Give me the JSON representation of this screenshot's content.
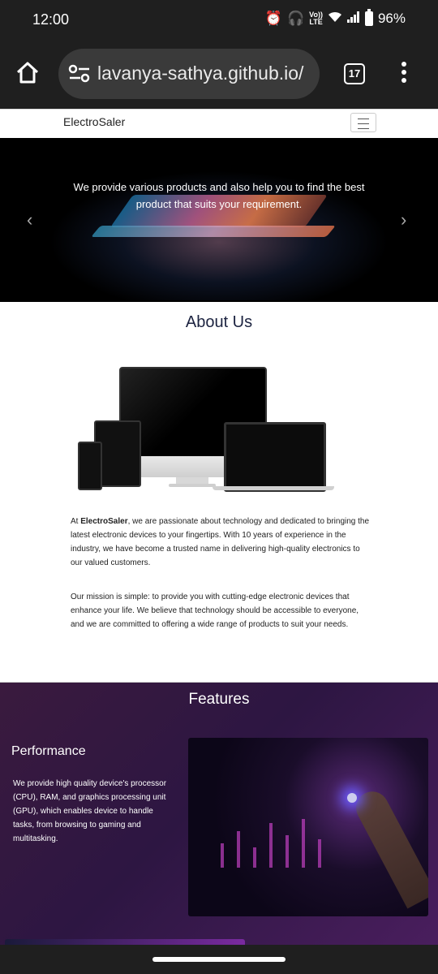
{
  "status_bar": {
    "time": "12:00",
    "network_label_top": "Vo))",
    "network_label_bottom": "LTE",
    "battery": "96%"
  },
  "browser": {
    "url": "lavanya-sathya.github.io/",
    "tab_count": "17"
  },
  "site": {
    "brand": "ElectroSaler"
  },
  "hero": {
    "caption": "We provide various products and also help you to find the best product that suits your requirement.",
    "prev_glyph": "‹",
    "next_glyph": "›"
  },
  "about": {
    "title": "About Us",
    "para1_prefix": "At ",
    "para1_brand": "ElectroSaler",
    "para1_rest": ", we are passionate about technology and dedicated to bringing the latest electronic devices to your fingertips. With 10 years of experience in the industry, we have become a trusted name in delivering high-quality electronics to our valued customers.",
    "para2": "Our mission is simple: to provide you with cutting-edge electronic devices that enhance your life. We believe that technology should be accessible to everyone, and we are committed to offering a wide range of products to suit your needs."
  },
  "features": {
    "title": "Features",
    "heading": "Performance",
    "text": "We provide high quality device's processor (CPU), RAM, and graphics processing unit (GPU), which enables device to handle tasks, from browsing to gaming and multitasking."
  }
}
